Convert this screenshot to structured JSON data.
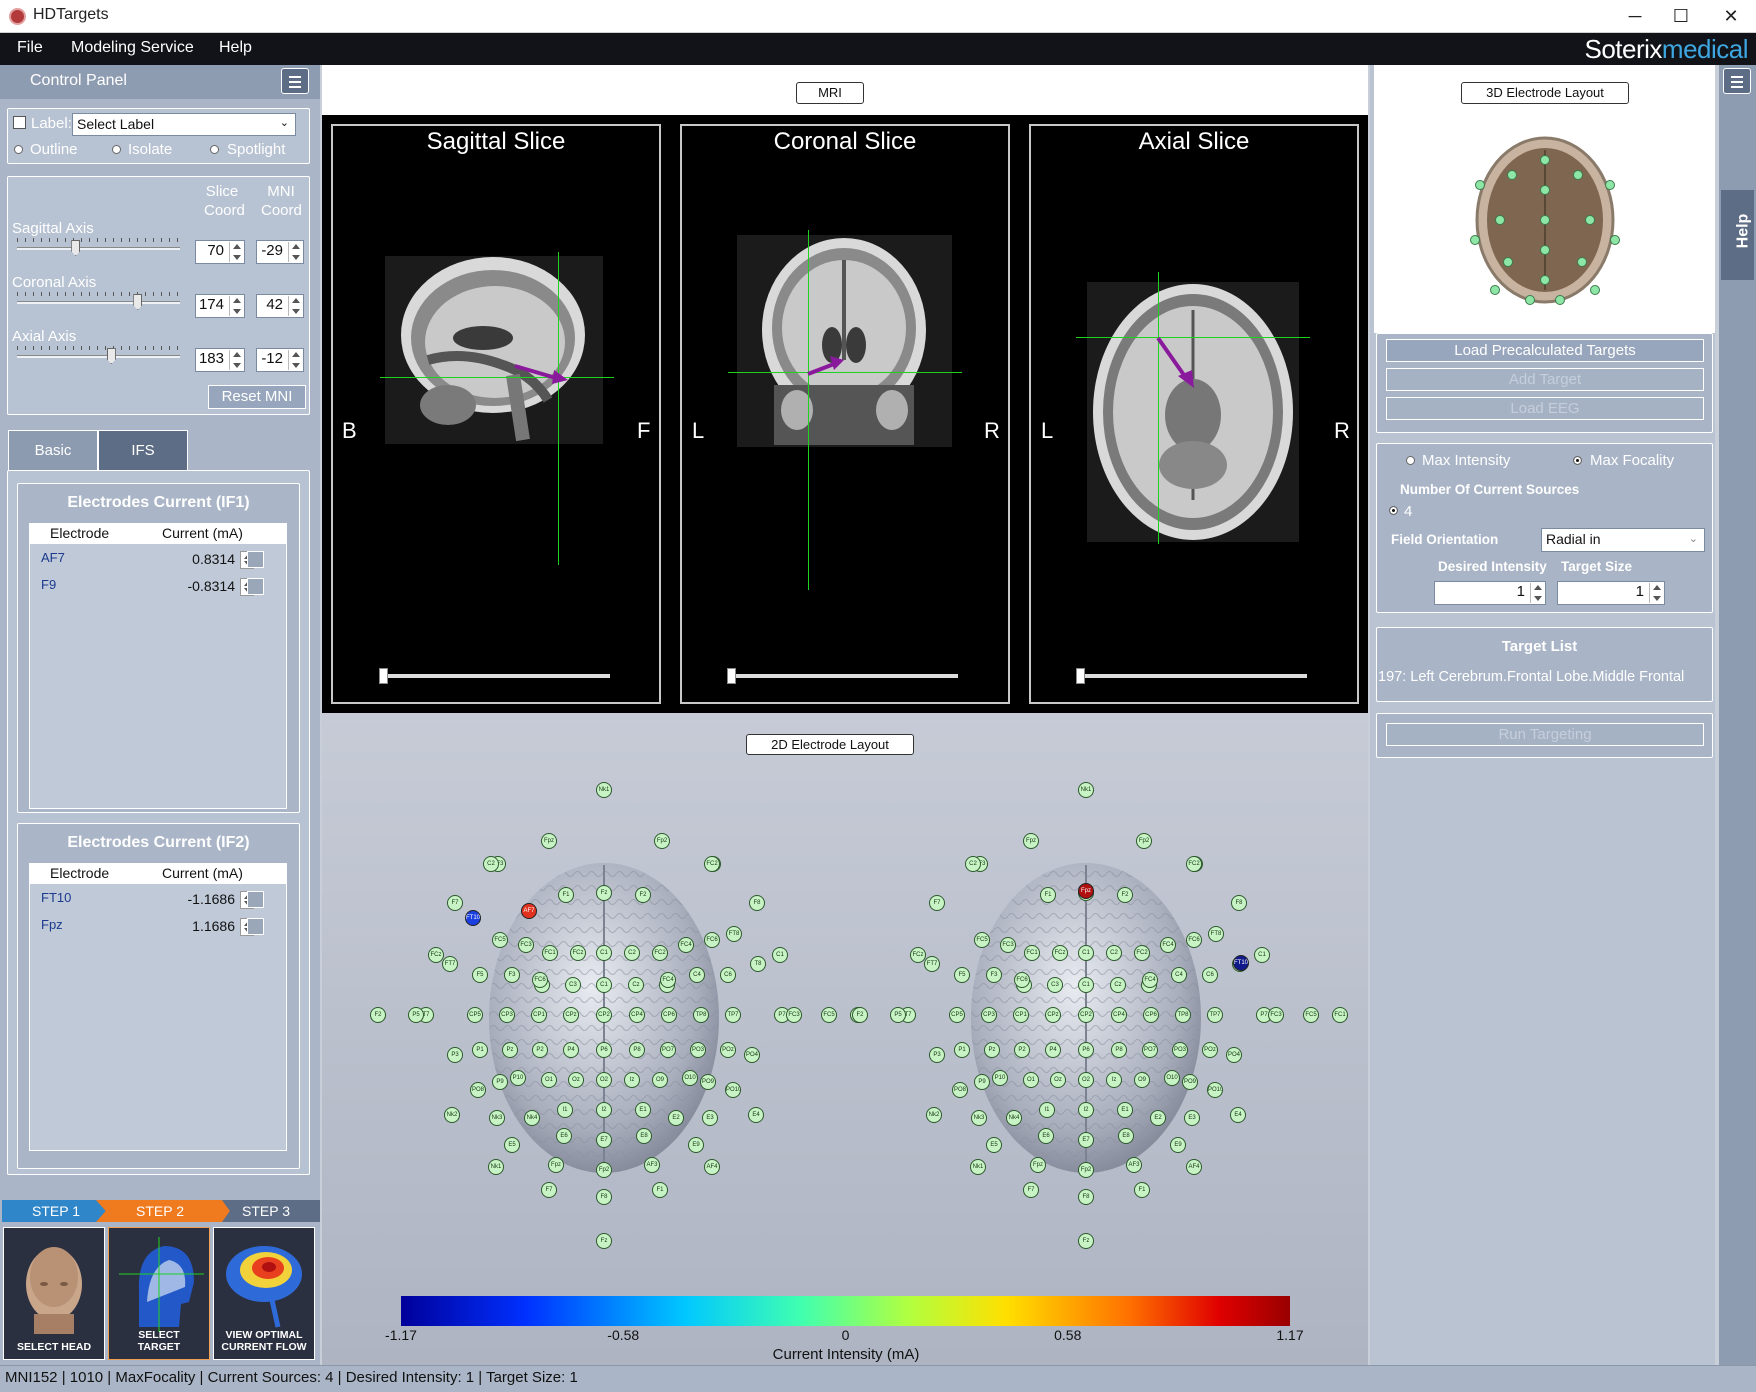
{
  "window": {
    "title": "HDTargets",
    "minimize": "─",
    "maximize": "☐",
    "close": "✕"
  },
  "menu": {
    "items": [
      "File",
      "Modeling Service",
      "Help"
    ],
    "brand_main": "Soterix",
    "brand_accent": "medical"
  },
  "control_panel": {
    "title": "Control Panel",
    "label_checkbox": "Label:",
    "label_select": "Select Label",
    "display_modes": [
      "Outline",
      "Isolate",
      "Spotlight"
    ],
    "col_slice": [
      "Slice",
      "Coord"
    ],
    "col_mni": [
      "MNI",
      "Coord"
    ],
    "axes": [
      {
        "name": "Sagittal Axis",
        "slice": "70",
        "mni": "-29",
        "position": 0.35
      },
      {
        "name": "Coronal Axis",
        "slice": "174",
        "mni": "42",
        "position": 0.75
      },
      {
        "name": "Axial Axis",
        "slice": "183",
        "mni": "-12",
        "position": 0.58
      }
    ],
    "reset_button": "Reset MNI",
    "tabs": [
      "Basic",
      "IFS"
    ],
    "if1": {
      "title": "Electrodes Current (IF1)",
      "headers": [
        "Electrode",
        "Current (mA)"
      ],
      "rows": [
        {
          "electrode": "AF7",
          "current": "0.8314"
        },
        {
          "electrode": "F9",
          "current": "-0.8314"
        }
      ]
    },
    "if2": {
      "title": "Electrodes Current (IF2)",
      "headers": [
        "Electrode",
        "Current (mA)"
      ],
      "rows": [
        {
          "electrode": "FT10",
          "current": "-1.1686"
        },
        {
          "electrode": "Fpz",
          "current": "1.1686"
        }
      ]
    }
  },
  "steps": {
    "labels": [
      "STEP 1",
      "STEP 2",
      "STEP 3"
    ],
    "cards": [
      [
        "SELECT HEAD"
      ],
      [
        "SELECT",
        "TARGET"
      ],
      [
        "VIEW OPTIMAL",
        "CURRENT FLOW"
      ]
    ]
  },
  "mri": {
    "button": "MRI",
    "slices": [
      {
        "title": "Sagittal Slice",
        "left": "B",
        "right": "F"
      },
      {
        "title": "Coronal Slice",
        "left": "L",
        "right": "R"
      },
      {
        "title": "Axial Slice",
        "left": "L",
        "right": "R"
      }
    ]
  },
  "layout2d": {
    "button": "2D Electrode Layout",
    "colorbar_ticks": [
      "-1.17",
      "-0.58",
      "0",
      "0.58",
      "1.17"
    ],
    "colorbar_label": "Current Intensity (mA)",
    "left_labels": [
      "AF7",
      "FT10"
    ],
    "right_labels": [
      "Fpz",
      "FT10"
    ]
  },
  "right_panel": {
    "layout3d_button": "3D Electrode Layout",
    "buttons": [
      "Load Precalculated Targets",
      "Add Target",
      "Load EEG"
    ],
    "modes": [
      "Max Intensity",
      "Max Focality"
    ],
    "num_sources_label": "Number Of Current Sources",
    "num_sources_value": "4",
    "field_orientation_label": "Field Orientation",
    "field_orientation_value": "Radial in",
    "desired_intensity_label": "Desired Intensity",
    "desired_intensity_value": "1",
    "target_size_label": "Target Size",
    "target_size_value": "1",
    "target_list_title": "Target List",
    "target_list_item": "197: Left Cerebrum.Frontal Lobe.Middle Frontal",
    "run_button": "Run Targeting",
    "help_tab": "Help"
  },
  "status": "MNI152 | 1010 | MaxFocality | Current Sources: 4 | Desired Intensity: 1 | Target Size: 1",
  "colors": {
    "anode_left": "#e0321e",
    "cathode_left": "#1c3fe0",
    "anode_right": "#b01010",
    "cathode_right": "#101a8a",
    "crosshair": "#1fd21f",
    "arrow": "#8a1a9c"
  }
}
